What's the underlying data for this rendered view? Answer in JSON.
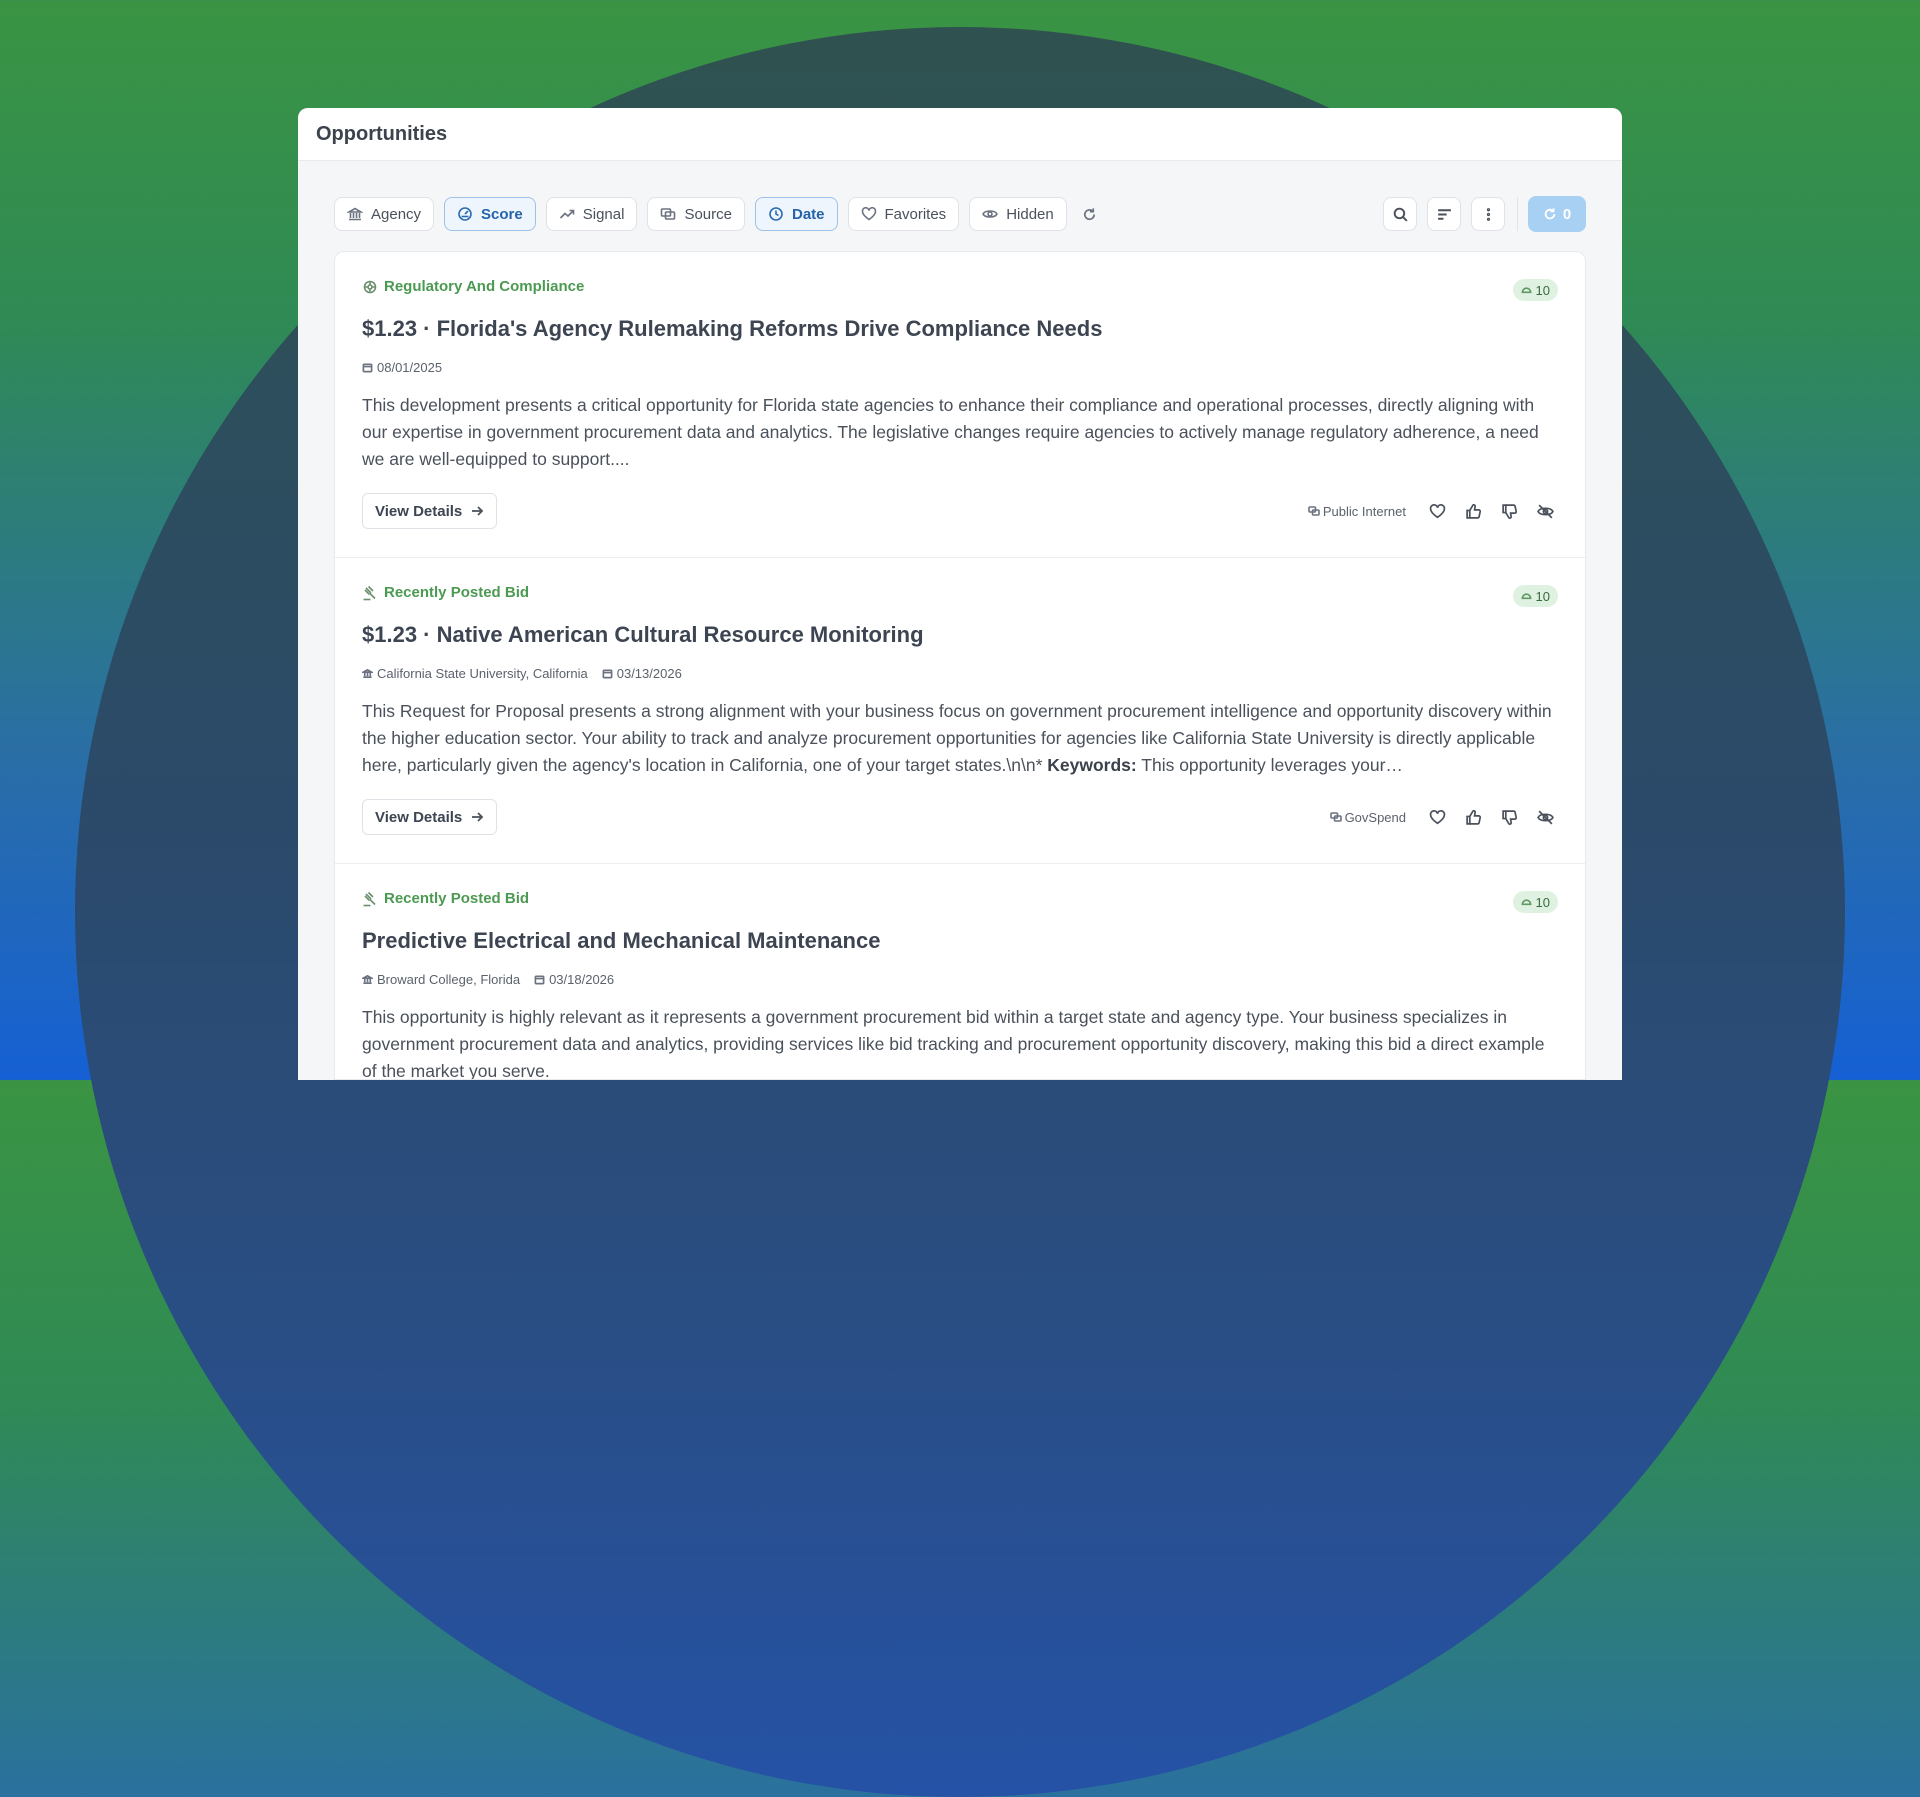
{
  "window": {
    "title": "Opportunities"
  },
  "filters": [
    {
      "label": "Agency",
      "icon": "bank-icon",
      "active": false
    },
    {
      "label": "Score",
      "icon": "gauge-icon",
      "active": true
    },
    {
      "label": "Signal",
      "icon": "trending-up-icon",
      "active": false
    },
    {
      "label": "Source",
      "icon": "source-icon",
      "active": false
    },
    {
      "label": "Date",
      "icon": "clock-icon",
      "active": true
    },
    {
      "label": "Favorites",
      "icon": "heart-icon",
      "active": false
    },
    {
      "label": "Hidden",
      "icon": "eye-icon",
      "active": false
    }
  ],
  "toolbar": {
    "count": "0",
    "count_color": "#a8d0f2"
  },
  "cards": [
    {
      "category": "Regulatory And Compliance",
      "category_icon": "gear-lines-icon",
      "score": "10",
      "title": "$1.23 · Florida's Agency Rulemaking Reforms Drive Compliance Needs",
      "agency": "",
      "date": "08/01/2025",
      "description": "This development presents a critical opportunity for Florida state agencies to enhance their compliance and operational processes, directly aligning with our expertise in government procurement data and analytics. The legislative changes require agencies to actively manage regulatory adherence, a need we are well-equipped to support....",
      "description_bold": "",
      "description_tail": "",
      "view_label": "View Details",
      "source": "Public Internet"
    },
    {
      "category": "Recently Posted Bid",
      "category_icon": "gavel-icon",
      "score": "10",
      "title": "$1.23 · Native American Cultural Resource Monitoring",
      "agency": "California State University, California",
      "date": "03/13/2026",
      "description": "This Request for Proposal presents a strong alignment with your business focus on government procurement intelligence and opportunity discovery within the higher education sector. Your ability to track and analyze procurement opportunities for agencies like California State University is directly applicable here, particularly given the agency's location in California, one of your target states.\\n\\n* ",
      "description_bold": "Keywords:",
      "description_tail": " This opportunity leverages your…",
      "view_label": "View Details",
      "source": "GovSpend"
    },
    {
      "category": "Recently Posted Bid",
      "category_icon": "gavel-icon",
      "score": "10",
      "title": "Predictive Electrical and Mechanical Maintenance",
      "agency": "Broward College, Florida",
      "date": "03/18/2026",
      "description": "This opportunity is highly relevant as it represents a government procurement bid within a target state and agency type. Your business specializes in government procurement data and analytics, providing services like bid tracking and procurement opportunity discovery, making this bid a direct example of the market you serve.",
      "description_bold": "",
      "description_tail": "",
      "view_label": "View Details",
      "source": ""
    }
  ],
  "colors": {
    "accent": "#2563a8",
    "category_green": "#4c9a52",
    "badge_bg": "#dff1e0"
  }
}
